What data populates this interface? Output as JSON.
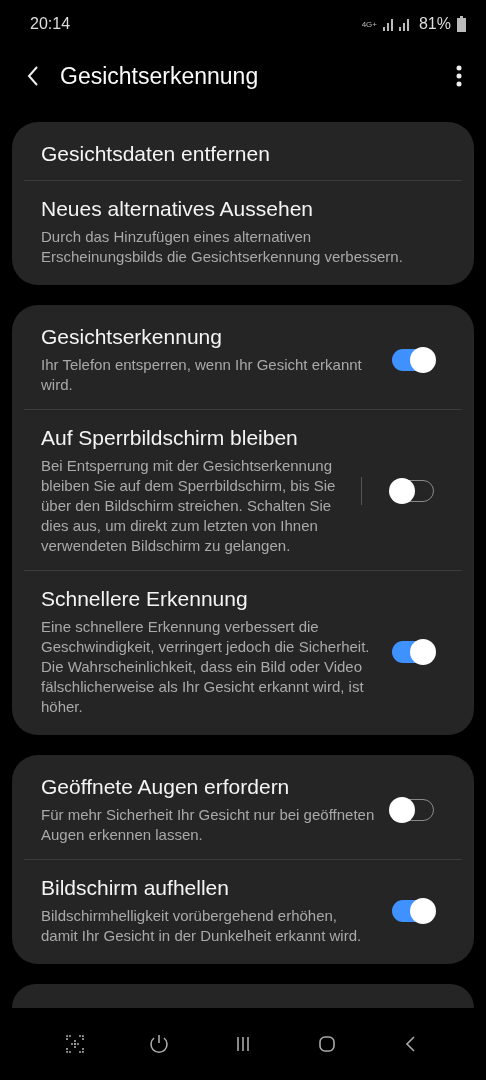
{
  "status_bar": {
    "time": "20:14",
    "network": "4G+",
    "battery": "81%"
  },
  "header": {
    "title": "Gesichtserkennung"
  },
  "cards": [
    {
      "items": [
        {
          "kind": "link",
          "title": "Gesichtsdaten entfernen"
        },
        {
          "kind": "link",
          "title": "Neues alternatives Aussehen",
          "description": "Durch das Hinzufügen eines alternativen Erscheinungsbilds die Gesichtserkennung verbessern."
        }
      ]
    },
    {
      "items": [
        {
          "kind": "toggle",
          "title": "Gesichtserkennung",
          "description": "Ihr Telefon entsperren, wenn Ihr Gesicht erkannt wird.",
          "on": true,
          "divider": false
        },
        {
          "kind": "toggle",
          "title": "Auf Sperrbildschirm bleiben",
          "description": "Bei Entsperrung mit der Gesichtserkennung bleiben Sie auf dem Sperrbildschirm, bis Sie über den Bildschirm streichen. Schalten Sie dies aus, um direkt zum letzten von Ihnen verwendeten Bildschirm zu gelangen.",
          "on": false,
          "divider": true
        },
        {
          "kind": "toggle",
          "title": "Schnellere Erkennung",
          "description": "Eine schnellere Erkennung verbessert die Geschwindigkeit, verringert jedoch die Sicherheit. Die Wahrscheinlichkeit, dass ein Bild oder Video fälschlicherweise als Ihr Gesicht erkannt wird, ist höher.",
          "on": true,
          "divider": false
        }
      ]
    },
    {
      "items": [
        {
          "kind": "toggle",
          "title": "Geöffnete Augen erfordern",
          "description": "Für mehr Sicherheit Ihr Gesicht nur bei geöffneten Augen erkennen lassen.",
          "on": false,
          "divider": false
        },
        {
          "kind": "toggle",
          "title": "Bildschirm aufhellen",
          "description": "Bildschirmhelligkeit vorübergehend erhöhen, damit Ihr Gesicht in der Dunkelheit erkannt wird.",
          "on": true,
          "divider": false
        }
      ]
    }
  ]
}
